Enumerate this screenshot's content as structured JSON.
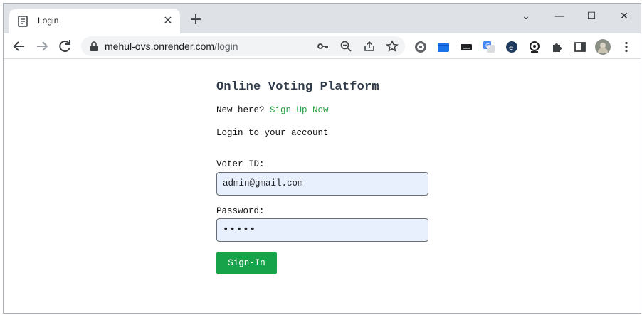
{
  "browser": {
    "tab_title": "Login",
    "tab_close": "✕",
    "new_tab": "+",
    "url_host": "mehul-ovs.onrender.com",
    "url_path": "/login",
    "window_controls": [
      "⌄",
      "—",
      "☐",
      "✕"
    ]
  },
  "page": {
    "title": "Online Voting Platform",
    "new_here": "New here?",
    "signup_link": "Sign-Up Now",
    "subtitle": "Login to your account",
    "voter_id_label": "Voter ID:",
    "voter_id_value": "admin@gmail.com",
    "password_label": "Password:",
    "password_value": "•••••",
    "signin_label": "Sign-In"
  },
  "colors": {
    "accent_green": "#16a34a",
    "link_green": "#26a047",
    "input_autofill": "#e8f0fe"
  },
  "icons": {
    "toolbar": [
      "back-arrow-icon",
      "forward-arrow-icon",
      "reload-icon",
      "lock-icon",
      "key-icon",
      "zoom-out-icon",
      "share-icon",
      "star-icon"
    ],
    "extensions": [
      "reel-icon",
      "folder-icon",
      "keyboard-icon",
      "translate-icon",
      "extension-e-icon",
      "webcam-icon",
      "puzzle-icon",
      "sidebar-icon",
      "avatar",
      "menu-dots-icon"
    ]
  }
}
